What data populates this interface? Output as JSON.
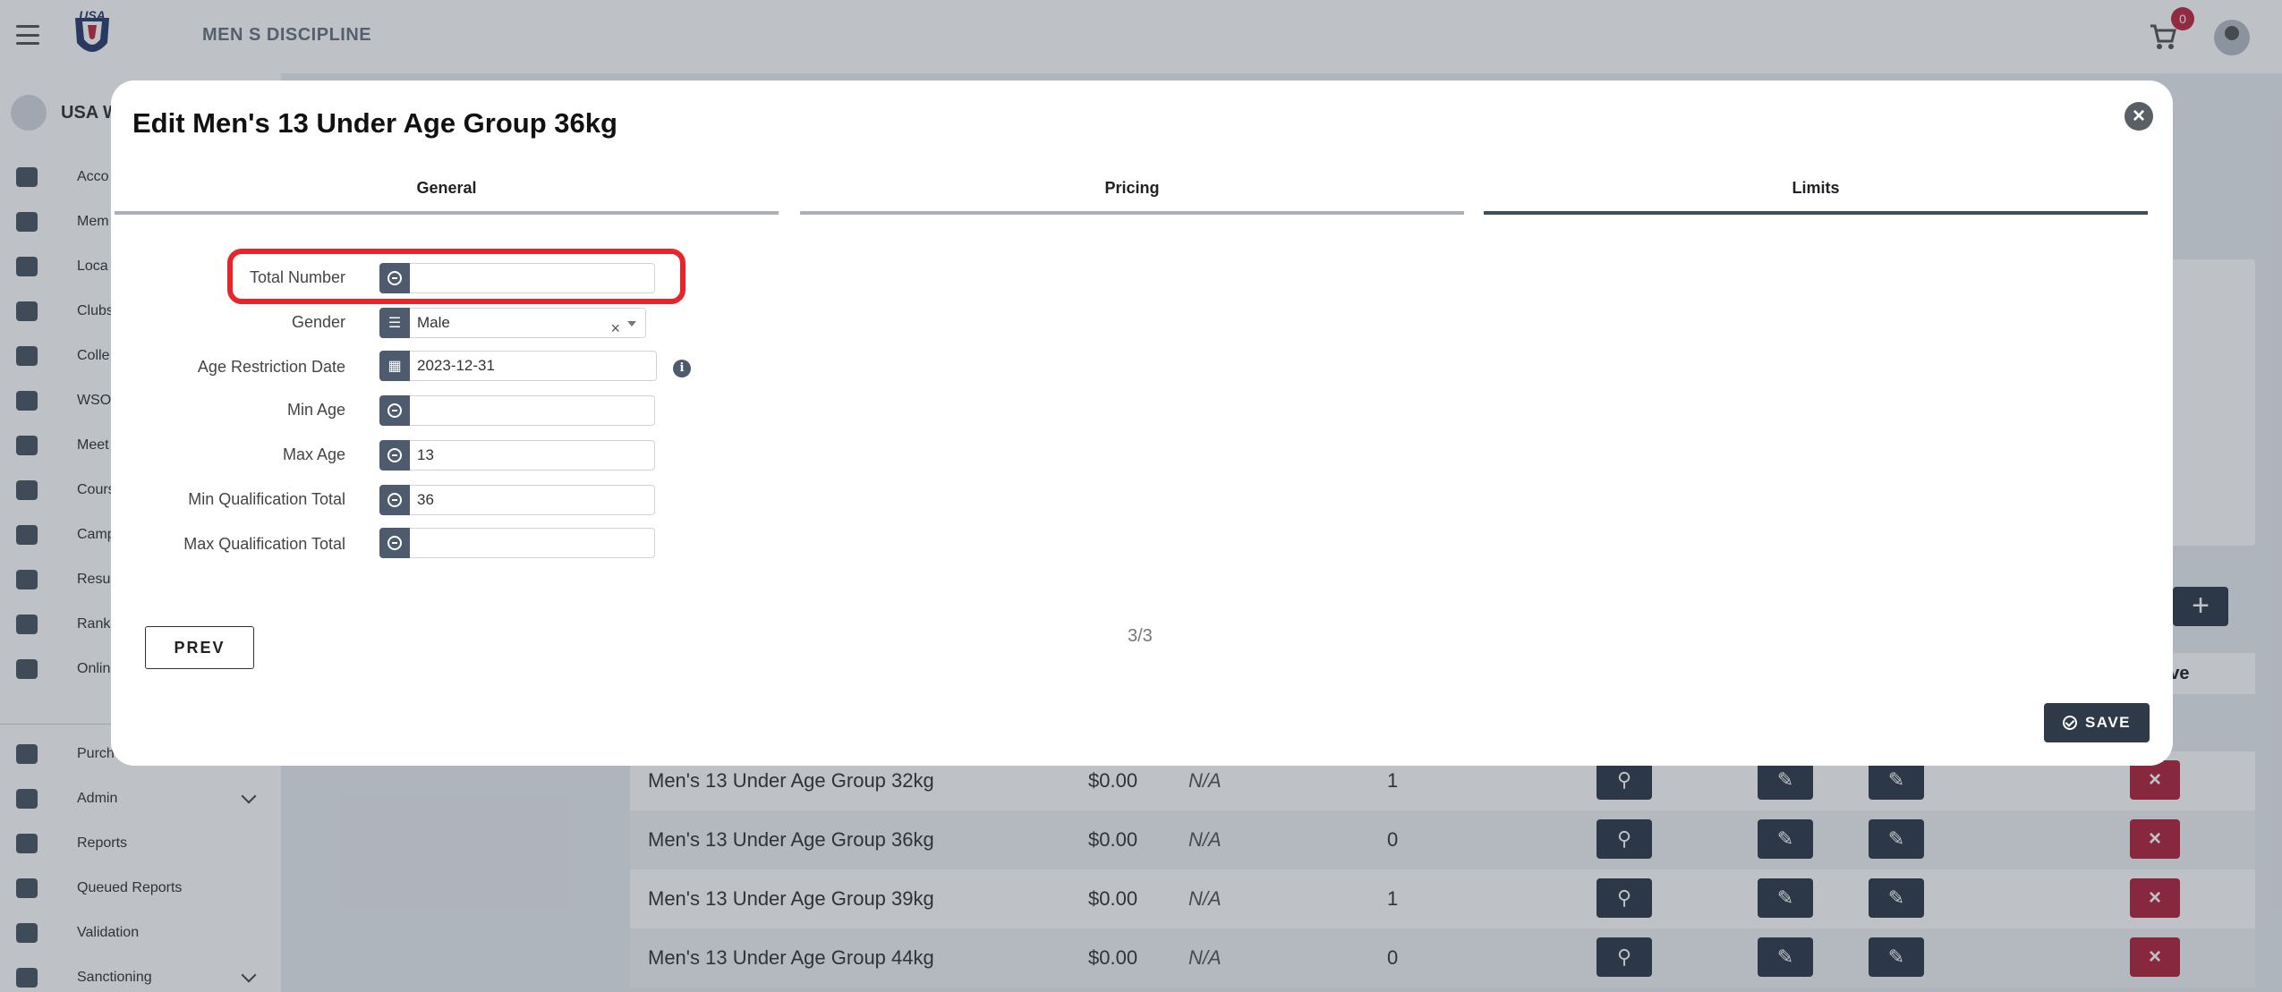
{
  "app": {
    "title": "MEN S DISCIPLINE",
    "cart_count": "0",
    "org_name": "USA W"
  },
  "sidebar": {
    "items": [
      {
        "label": "Acco",
        "icon": "person-icon"
      },
      {
        "label": "Mem",
        "icon": "people-icon"
      },
      {
        "label": "Loca",
        "icon": "weightlifter-icon"
      },
      {
        "label": "Clubs",
        "icon": "shield-icon"
      },
      {
        "label": "Colle",
        "icon": "school-icon"
      },
      {
        "label": "WSO",
        "icon": "weightlifter-icon"
      },
      {
        "label": "Meet",
        "icon": "trophy-icon"
      },
      {
        "label": "Cours",
        "icon": "school-icon"
      },
      {
        "label": "Camp",
        "icon": "map-icon"
      },
      {
        "label": "Resu",
        "icon": "bar-chart-icon"
      },
      {
        "label": "Rank",
        "icon": "bar-chart-icon"
      },
      {
        "label": "Onlin",
        "icon": "cart-icon"
      }
    ],
    "bottom_items": [
      {
        "label": "Purch",
        "icon": "purchase-history-icon",
        "chevron": false
      },
      {
        "label": "Admin",
        "icon": "gears-icon",
        "chevron": true
      },
      {
        "label": "Reports",
        "icon": "report-icon",
        "chevron": false
      },
      {
        "label": "Queued Reports",
        "icon": "queue-icon",
        "chevron": false
      },
      {
        "label": "Validation",
        "icon": "check-circle-icon",
        "chevron": false
      },
      {
        "label": "Sanctioning",
        "icon": "calendar-question-icon",
        "chevron": true
      }
    ]
  },
  "table": {
    "remove_header": "ove",
    "rows": [
      {
        "name": "Men's 13 Under Age Group 32kg",
        "price": "$0.00",
        "na": "N/A",
        "count": "1"
      },
      {
        "name": "Men's 13 Under Age Group 36kg",
        "price": "$0.00",
        "na": "N/A",
        "count": "0"
      },
      {
        "name": "Men's 13 Under Age Group 39kg",
        "price": "$0.00",
        "na": "N/A",
        "count": "1"
      },
      {
        "name": "Men's 13 Under Age Group 44kg",
        "price": "$0.00",
        "na": "N/A",
        "count": "0"
      }
    ]
  },
  "modal": {
    "title": "Edit Men's 13 Under Age Group 36kg",
    "tabs": [
      "General",
      "Pricing",
      "Limits"
    ],
    "active_tab": "Limits",
    "fields": {
      "total_number": {
        "label": "Total Number",
        "value": ""
      },
      "gender": {
        "label": "Gender",
        "value": "Male"
      },
      "age_restriction_date": {
        "label": "Age Restriction Date",
        "value": "2023-12-31"
      },
      "min_age": {
        "label": "Min Age",
        "value": ""
      },
      "max_age": {
        "label": "Max Age",
        "value": "13"
      },
      "min_qualification_total": {
        "label": "Min Qualification Total",
        "value": "36"
      },
      "max_qualification_total": {
        "label": "Max Qualification Total",
        "value": ""
      }
    },
    "prev_label": "PREV",
    "pager": "3/3",
    "save_label": "SAVE"
  },
  "colors": {
    "highlight": "#e8242b",
    "primary_dark": "#2f3a48",
    "danger": "#b0233c"
  }
}
